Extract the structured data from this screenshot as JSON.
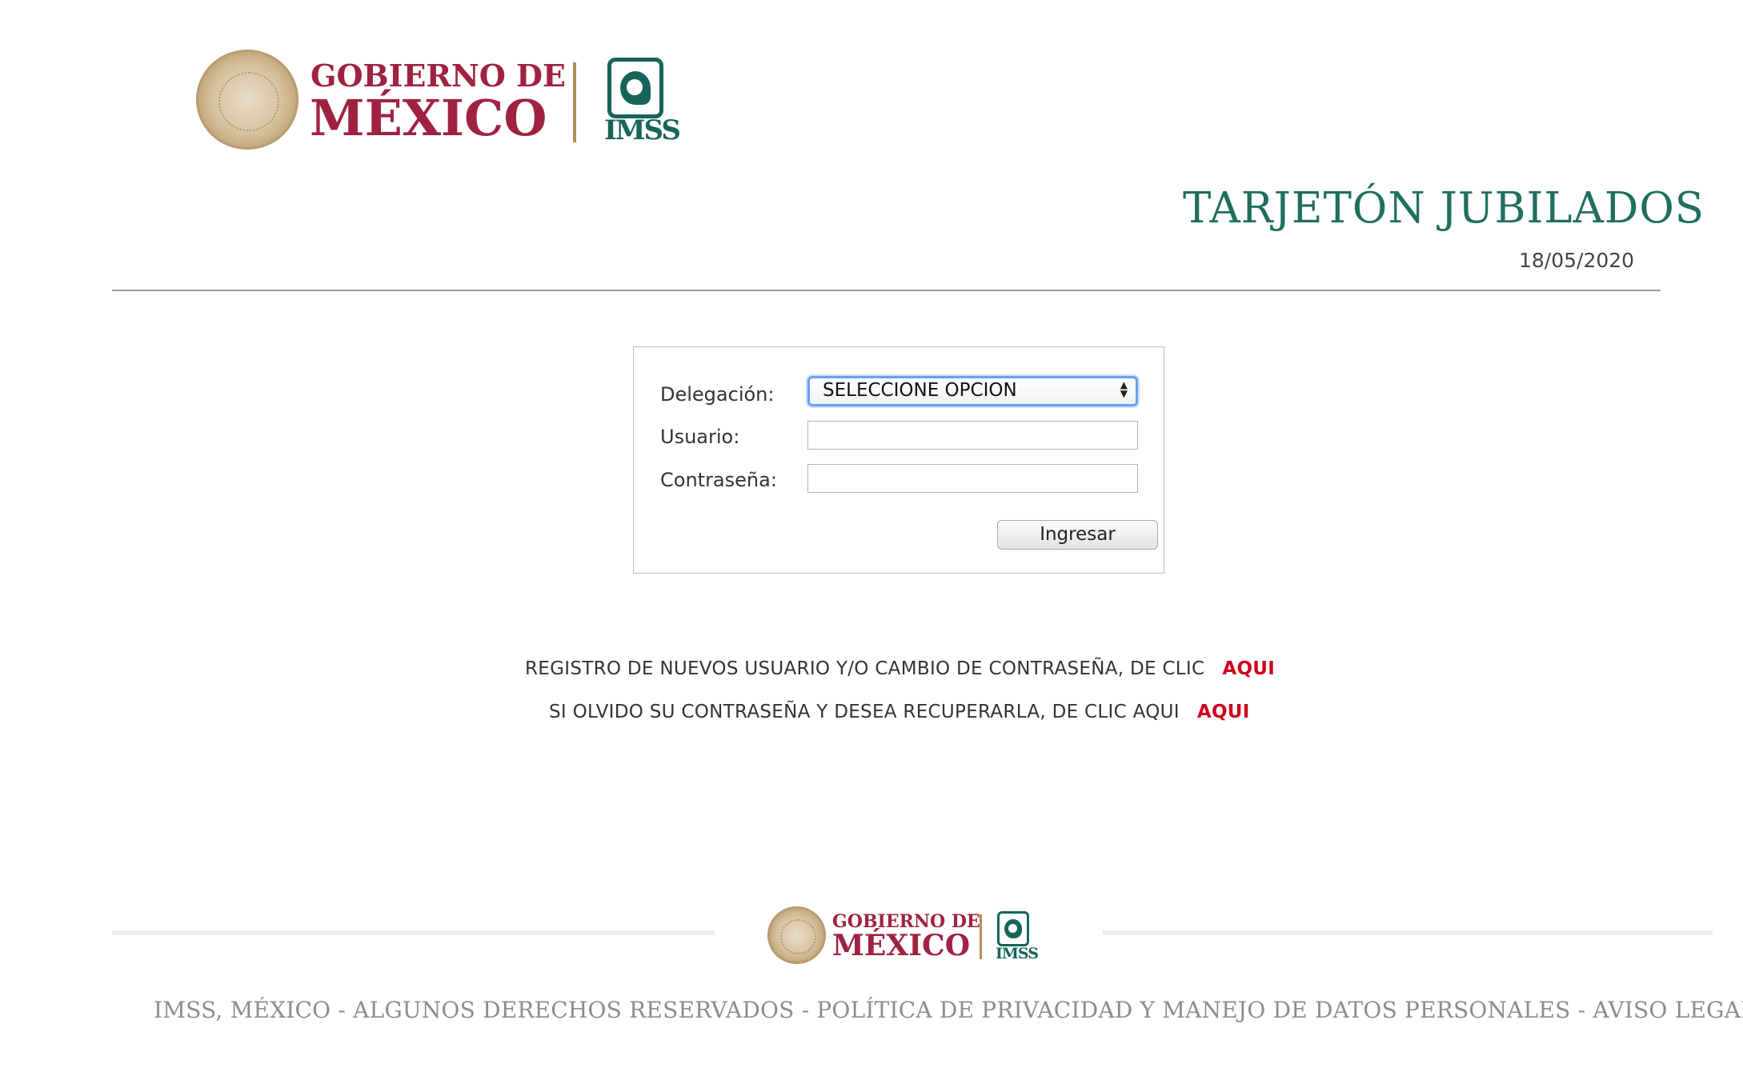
{
  "header": {
    "gov_line1": "GOBIERNO DE",
    "gov_line2": "MÉXICO",
    "imss_label": "IMSS",
    "title": "TARJETÓN JUBILADOS",
    "date": "18/05/2020"
  },
  "login": {
    "delegacion_label": "Delegación:",
    "delegacion_selected": "SELECCIONE OPCION",
    "usuario_label": "Usuario:",
    "usuario_value": "",
    "contrasena_label": "Contraseña:",
    "contrasena_value": "",
    "submit_label": "Ingresar"
  },
  "notices": {
    "register_text": "REGISTRO DE NUEVOS USUARIO Y/O CAMBIO DE CONTRASEÑA, DE CLIC",
    "register_link": "AQUI",
    "recover_text": "SI OLVIDO SU CONTRASEÑA Y DESEA RECUPERARLA, DE CLIC AQUI",
    "recover_link": "AQUI"
  },
  "footer": {
    "gov_line1": "GOBIERNO DE",
    "gov_line2": "MÉXICO",
    "imss_label": "IMSS",
    "legal": "IMSS, MÉXICO - ALGUNOS DERECHOS RESERVADOS - POLÍTICA DE PRIVACIDAD Y MANEJO DE DATOS PERSONALES - AVISO LEGAL"
  },
  "colors": {
    "gov_red": "#9f2241",
    "imss_green": "#17655a",
    "title_green": "#1f6e5e",
    "link_red": "#d0021b",
    "gold": "#b38e5d"
  },
  "icons": [
    "mexico-seal-icon",
    "imss-emblem-icon",
    "select-arrows-icon"
  ]
}
